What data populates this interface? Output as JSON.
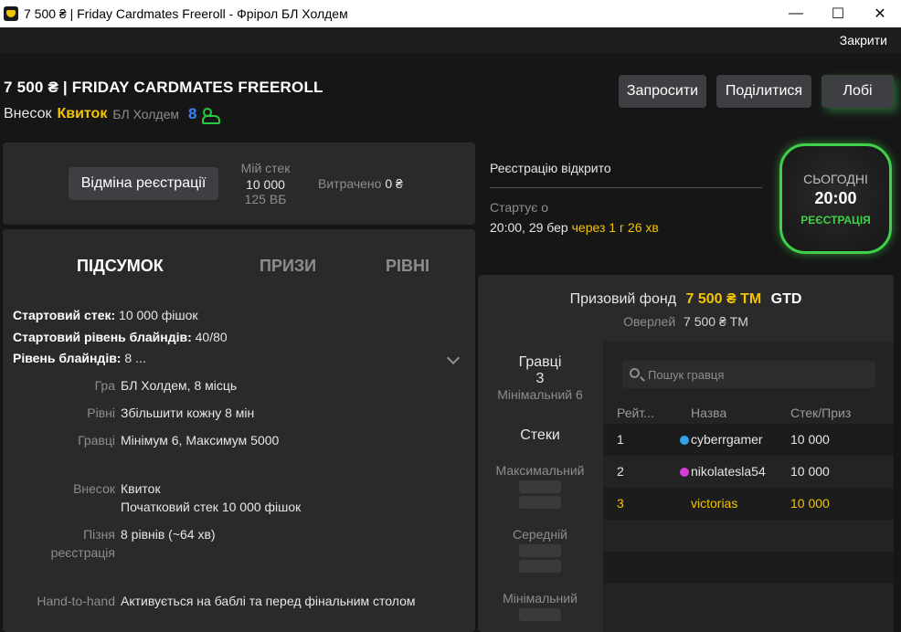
{
  "window": {
    "title": "7 500 ₴ | Friday Cardmates Freeroll - Фрірол БЛ Холдем",
    "minimize": "—",
    "maximize": "☐",
    "close": "✕"
  },
  "topbar": {
    "close_label": "Закрити"
  },
  "header": {
    "title": "7 500 ₴ | FRIDAY CARDMATES FREEROLL",
    "buyin_label": "Внесок",
    "buyin_value": "Квиток",
    "game": "БЛ Холдем",
    "players_count": "8",
    "buttons": {
      "invite": "Запросити",
      "share": "Поділитися",
      "lobby": "Лобі"
    }
  },
  "registration": {
    "unregister_label": "Відміна реєстрації",
    "my_stack_label": "Мій стек",
    "my_stack_value": "10 000",
    "my_stack_bb": "125 ВБ",
    "spent_label": "Витрачено",
    "spent_value": "0 ₴"
  },
  "tabs": {
    "summary": "ПІДСУМОК",
    "prizes": "ПРИЗИ",
    "levels": "РІВНІ"
  },
  "summary": {
    "start_stack_label": "Стартовий стек:",
    "start_stack_value": "10 000 фішок",
    "start_blinds_label": "Стартовий рівень блайндів:",
    "start_blinds_value": "40/80",
    "blind_level_label": "Рівень блайндів:",
    "blind_level_value": "8 ...",
    "rows": [
      {
        "label": "Гра",
        "value": "БЛ Холдем, 8 місць"
      },
      {
        "label": "Рівні",
        "value": "Збільшити кожну 8 мін"
      },
      {
        "label": "Гравці",
        "value": "Мінімум 6, Максимум 5000"
      },
      {
        "label": "Внесок",
        "value": "Квиток",
        "value2": "Початковий стек 10 000 фішок"
      },
      {
        "label": "Пізня",
        "label2": "реєстрація",
        "value": "8 рівнів (~64 хв)"
      },
      {
        "label": "Hand-to-hand",
        "value": "Активується на баблі та перед фінальним столом"
      }
    ]
  },
  "status": {
    "reg_open": "Реєстрацію відкрито",
    "starts_label": "Стартує о",
    "starts_time": "20:00, 29 бер",
    "starts_in": "через 1 г 26 хв"
  },
  "today_badge": {
    "label": "СЬОГОДНІ",
    "time": "20:00",
    "status": "РЕЄСТРАЦІЯ"
  },
  "prize": {
    "label": "Призовий фонд",
    "amount": "7 500 ₴ ТМ",
    "gtd": "GTD",
    "overlay_label": "Оверлей",
    "overlay_value": "7 500 ₴ ТМ"
  },
  "players_side": {
    "title": "Гравці",
    "count": "3",
    "minimum": "Мінімальний 6",
    "stacks_title": "Стеки",
    "max_label": "Максимальний",
    "avg_label": "Середній",
    "min_label": "Мінімальний"
  },
  "players_table": {
    "search_placeholder": "Пошук гравця",
    "headers": {
      "rank": "Рейт...",
      "name": "Назва",
      "stack": "Стек/Приз"
    },
    "rows": [
      {
        "rank": "1",
        "name": "cyberrgamer",
        "stack": "10 000",
        "dot_color": "#2fa3e6"
      },
      {
        "rank": "2",
        "name": "nikolatesla54",
        "stack": "10 000",
        "dot_color": "#d63bd6"
      },
      {
        "rank": "3",
        "name": "victorias",
        "stack": "10 000"
      }
    ]
  },
  "colors": {
    "accent_yellow": "#f3c400",
    "accent_green": "#3fd14a",
    "players_blue": "#3b82f6"
  }
}
